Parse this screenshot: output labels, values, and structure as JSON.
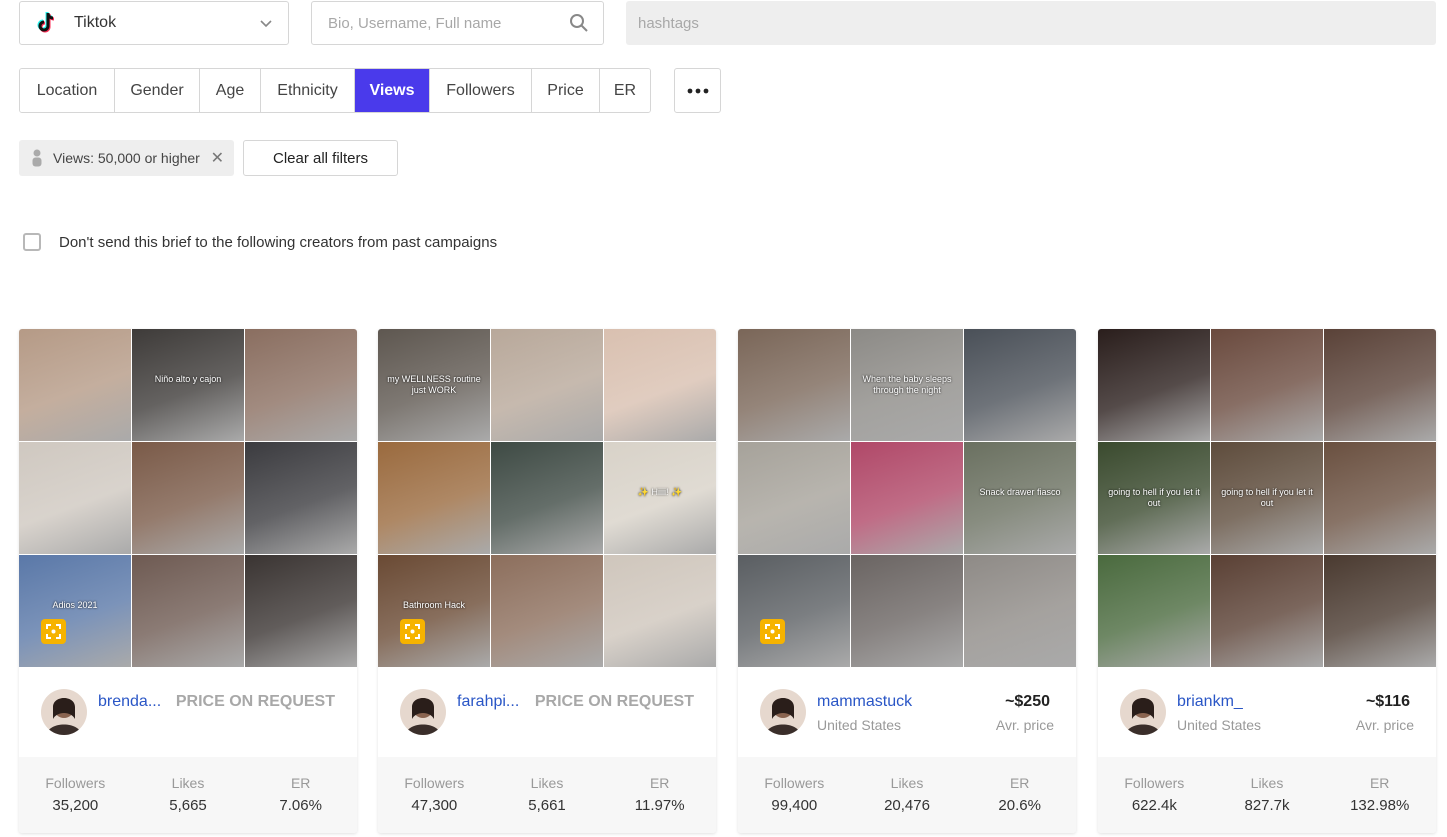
{
  "platform": {
    "label": "Tiktok",
    "icon": "tiktok-icon"
  },
  "search": {
    "placeholder": "Bio, Username, Full name"
  },
  "hashtags": {
    "placeholder": "hashtags"
  },
  "filter_tabs": [
    {
      "label": "Location",
      "active": false
    },
    {
      "label": "Gender",
      "active": false
    },
    {
      "label": "Age",
      "active": false
    },
    {
      "label": "Ethnicity",
      "active": false
    },
    {
      "label": "Views",
      "active": true
    },
    {
      "label": "Followers",
      "active": false
    },
    {
      "label": "Price",
      "active": false
    },
    {
      "label": "ER",
      "active": false
    }
  ],
  "more_button": {
    "icon": "more-dots-icon"
  },
  "active_filter": {
    "label": "Views: 50,000 or higher",
    "icon": "person-icon"
  },
  "clear_filters": {
    "label": "Clear all filters"
  },
  "exclude_past": {
    "label": "Don't send this brief to the following creators from past campaigns",
    "checked": false
  },
  "stat_labels": {
    "followers": "Followers",
    "likes": "Likes",
    "er": "ER"
  },
  "colors": {
    "accent": "#4a3aeb",
    "link": "#2a56c6",
    "badge": "#f6b300"
  },
  "creators": [
    {
      "username": "brenda...",
      "country": "",
      "price": "PRICE ON REQUEST",
      "price_caption": "",
      "followers": "35,200",
      "likes": "5,665",
      "er": "7.06%",
      "badge": true,
      "thumb_captions": [
        "",
        "Niño alto y cajon",
        "",
        "",
        "",
        "",
        "Adios 2021",
        "",
        ""
      ],
      "thumb_colors": [
        "#b59a86",
        "#3e3b39",
        "#8a6e60",
        "#cfc8c0",
        "#7a5a48",
        "#3b3b3f",
        "#5a78a8",
        "#6e5a52",
        "#3a3432"
      ]
    },
    {
      "username": "farahpi...",
      "country": "",
      "price": "PRICE ON REQUEST",
      "price_caption": "",
      "followers": "47,300",
      "likes": "5,661",
      "er": "11.97%",
      "badge": true,
      "thumb_captions": [
        "my WELLNESS routine just WORK",
        "",
        "",
        "",
        "",
        "✨ Hiiii! ✨",
        "Bathroom Hack",
        "",
        ""
      ],
      "thumb_colors": [
        "#5e5750",
        "#b8a89a",
        "#d9c0b0",
        "#9a6a3e",
        "#3e4a44",
        "#d8d2c8",
        "#6a4a34",
        "#8c6e5c",
        "#cfc6bc"
      ]
    },
    {
      "username": "mammastuck",
      "country": "United States",
      "price": "~$250",
      "price_caption": "Avr. price",
      "followers": "99,400",
      "likes": "20,476",
      "er": "20.6%",
      "badge": true,
      "thumb_captions": [
        "",
        "When the baby sleeps through the night",
        "",
        "",
        "",
        "Snack drawer fiasco",
        "",
        "",
        ""
      ],
      "thumb_colors": [
        "#7a6658",
        "#8c8a86",
        "#4a5058",
        "#a6a29a",
        "#b04868",
        "#6a7060",
        "#5a5e62",
        "#6a6462",
        "#8e8a86"
      ]
    },
    {
      "username": "briankm_",
      "country": "United States",
      "price": "~$116",
      "price_caption": "Avr. price",
      "followers": "622.4k",
      "likes": "827.7k",
      "er": "132.98%",
      "badge": false,
      "thumb_captions": [
        "",
        "",
        "",
        "going to hell if you let it out",
        "going to hell if you let it out",
        "",
        "",
        "",
        ""
      ],
      "thumb_colors": [
        "#2a1e1c",
        "#6a4a3e",
        "#5a4238",
        "#3a4a2e",
        "#5e4c3c",
        "#6a5040",
        "#4a6a3e",
        "#5a4034",
        "#4a3a30"
      ]
    }
  ]
}
